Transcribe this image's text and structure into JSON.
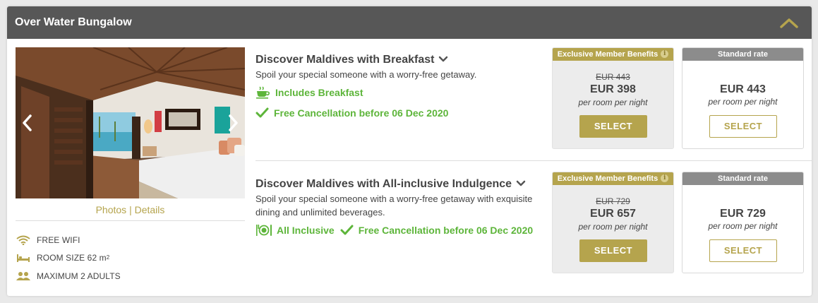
{
  "room": {
    "title": "Over Water Bungalow",
    "photo_links": {
      "photos": "Photos",
      "separator": " | ",
      "details": "Details"
    },
    "amenities": [
      {
        "icon": "wifi-icon",
        "label": "FREE WIFI"
      },
      {
        "icon": "bed-icon",
        "label": "ROOM SIZE 62 m",
        "sup": "2"
      },
      {
        "icon": "adults-icon",
        "label": "MAXIMUM 2 ADULTS"
      }
    ]
  },
  "offers": [
    {
      "title": "Discover Maldives with Breakfast",
      "description": "Spoil your special someone with a worry-free getaway.",
      "perks": [
        {
          "icon": "coffee-cup-icon",
          "label": "Includes Breakfast"
        },
        {
          "icon": "check-icon",
          "label": "Free Cancellation before 06 Dec 2020"
        }
      ],
      "member_rate": {
        "header": "Exclusive Member Benefits",
        "old_price": "EUR 443",
        "price": "EUR 398",
        "unit": "per room per night",
        "button": "SELECT"
      },
      "standard_rate": {
        "header": "Standard rate",
        "price": "EUR 443",
        "unit": "per room per night",
        "button": "SELECT"
      }
    },
    {
      "title": "Discover Maldives with All-inclusive Indulgence",
      "description": "Spoil your special someone with a worry-free getaway with exquisite dining and unlimited beverages.",
      "perks": [
        {
          "icon": "dining-icon",
          "label": "All Inclusive"
        },
        {
          "icon": "check-icon",
          "label": "Free Cancellation before 06 Dec 2020"
        }
      ],
      "member_rate": {
        "header": "Exclusive Member Benefits",
        "old_price": "EUR 729",
        "price": "EUR 657",
        "unit": "per room per night",
        "button": "SELECT"
      },
      "standard_rate": {
        "header": "Standard rate",
        "price": "EUR 729",
        "unit": "per room per night",
        "button": "SELECT"
      }
    }
  ],
  "colors": {
    "header_bg": "#575757",
    "accent_gold": "#b5a44d",
    "perk_green": "#5db53a",
    "standard_head": "#8c8c8c"
  }
}
